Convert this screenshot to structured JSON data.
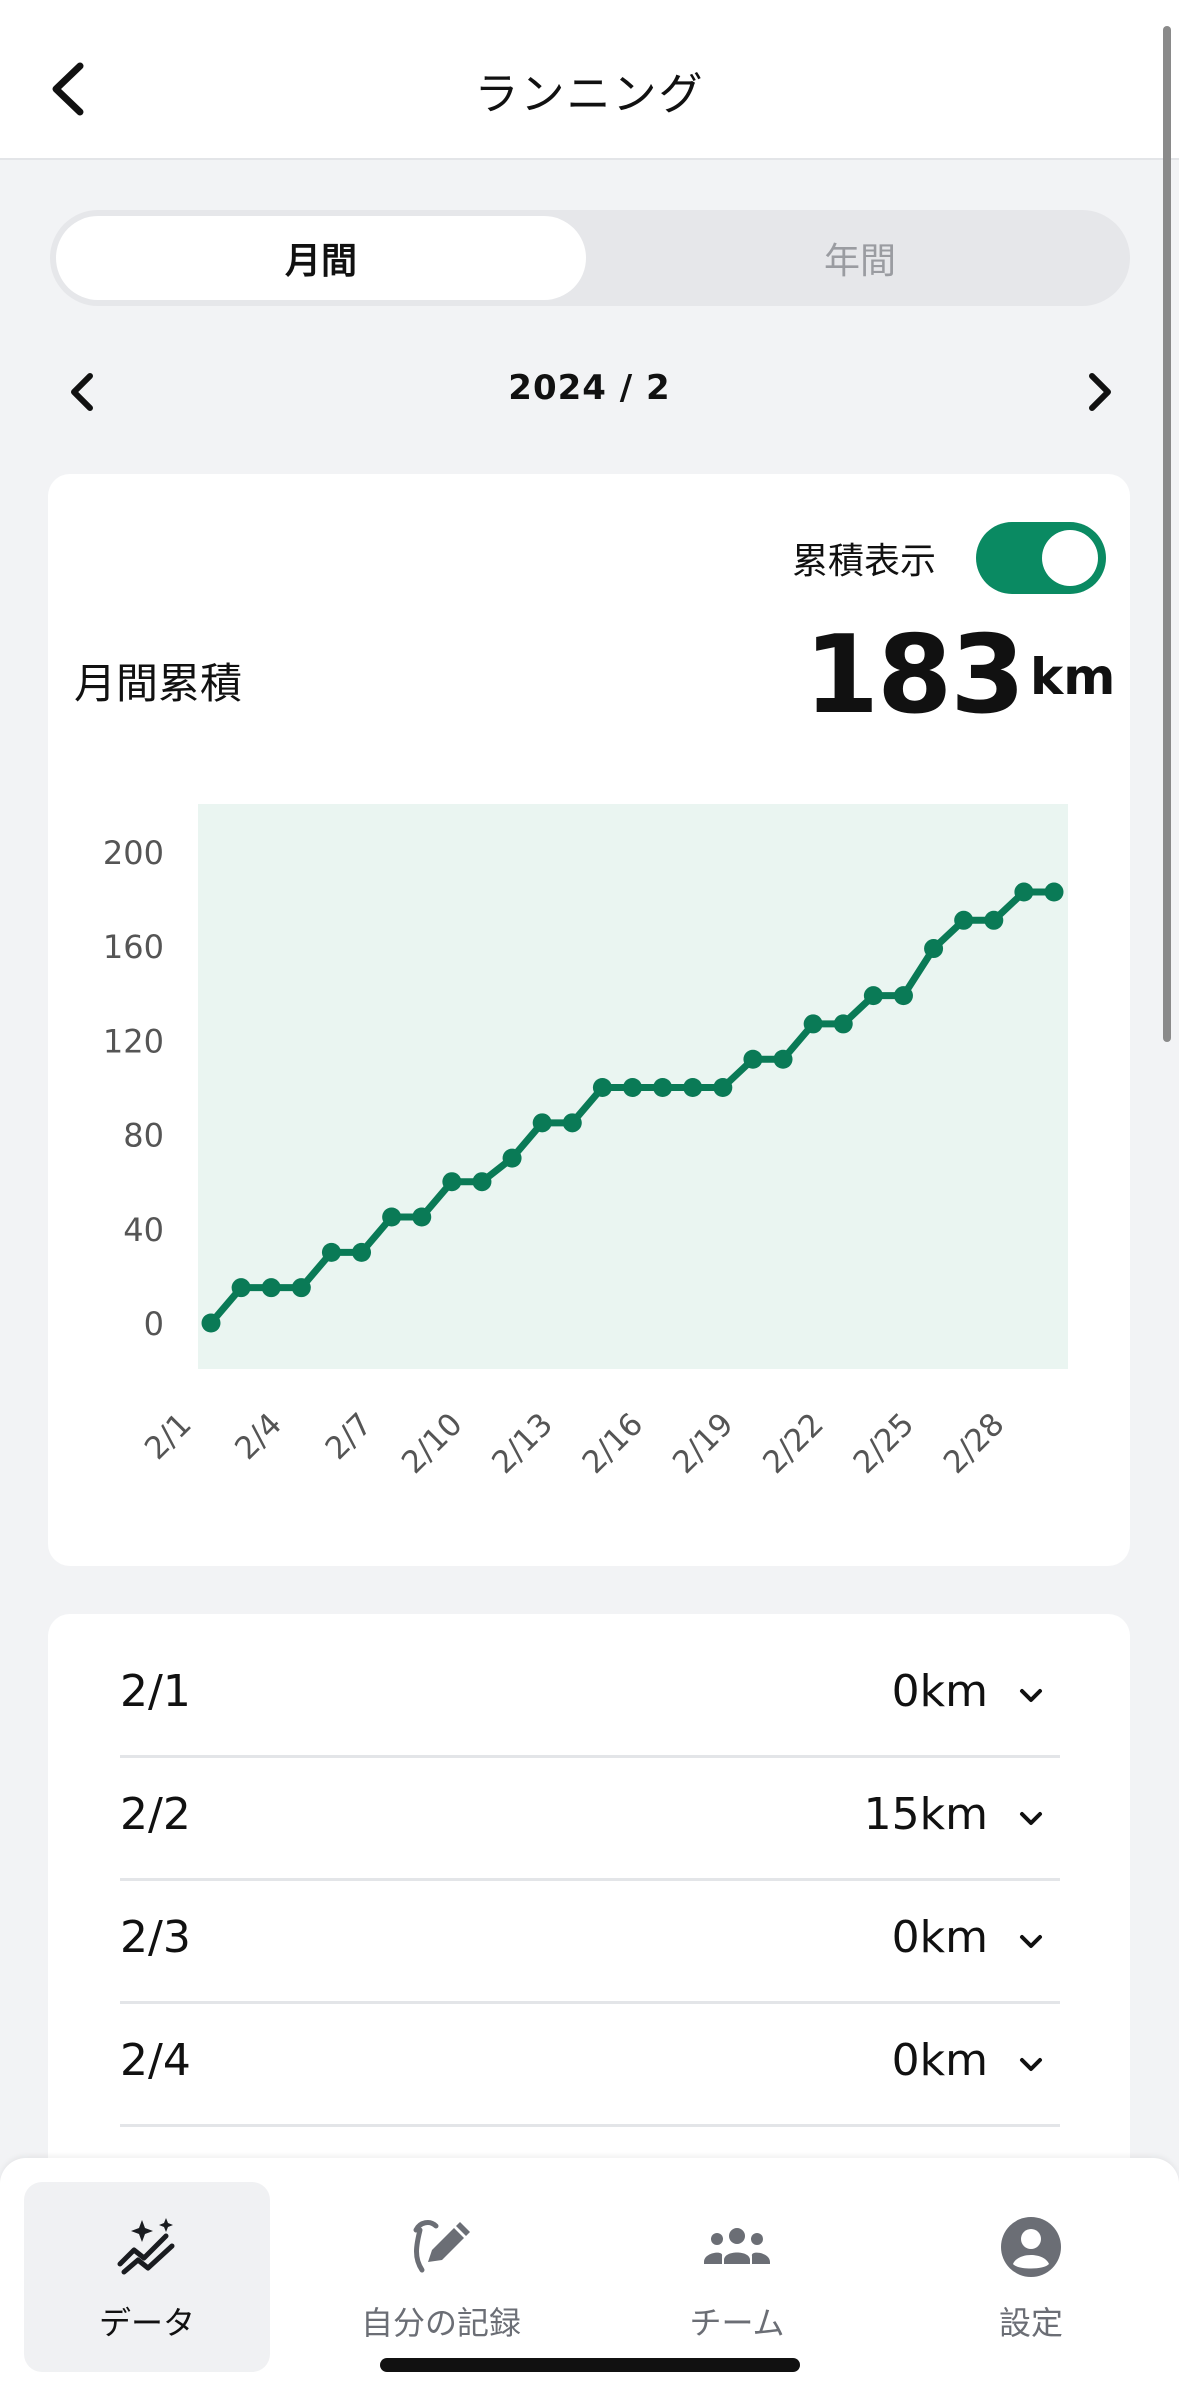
{
  "header": {
    "title": "ランニング"
  },
  "segments": {
    "monthly": "月間",
    "yearly": "年間"
  },
  "month_nav": {
    "label": "2024 / 2"
  },
  "summary": {
    "toggle_label": "累積表示",
    "toggle_on": true,
    "label": "月間累積",
    "value": "183",
    "unit": "km"
  },
  "chart_data": {
    "type": "line",
    "x": [
      "2/1",
      "2/2",
      "2/3",
      "2/4",
      "2/5",
      "2/6",
      "2/7",
      "2/8",
      "2/9",
      "2/10",
      "2/11",
      "2/12",
      "2/13",
      "2/14",
      "2/15",
      "2/16",
      "2/17",
      "2/18",
      "2/19",
      "2/20",
      "2/21",
      "2/22",
      "2/23",
      "2/24",
      "2/25",
      "2/26",
      "2/27",
      "2/28",
      "2/29"
    ],
    "tick_labels": [
      "2/1",
      "2/4",
      "2/7",
      "2/10",
      "2/13",
      "2/16",
      "2/19",
      "2/22",
      "2/25",
      "2/28"
    ],
    "y_ticks": [
      "0",
      "40",
      "80",
      "120",
      "160",
      "200"
    ],
    "series": [
      {
        "values": [
          0,
          15,
          15,
          15,
          30,
          30,
          45,
          45,
          60,
          60,
          70,
          85,
          85,
          100,
          100,
          100,
          100,
          100,
          112,
          112,
          127,
          127,
          139,
          139,
          159,
          171,
          171,
          183,
          183
        ]
      }
    ],
    "ylim": [
      0,
      200
    ],
    "grid": false,
    "colors": {
      "line": "#0a7a56",
      "plot_bg": "#eaf5f1"
    }
  },
  "daily_list": [
    {
      "date": "2/1",
      "value": "0km"
    },
    {
      "date": "2/2",
      "value": "15km"
    },
    {
      "date": "2/3",
      "value": "0km"
    },
    {
      "date": "2/4",
      "value": "0km"
    }
  ],
  "tabbar": [
    {
      "label": "データ",
      "icon": "sparkle-chart-icon",
      "active": true
    },
    {
      "label": "自分の記録",
      "icon": "edit-record-icon",
      "active": false
    },
    {
      "label": "チーム",
      "icon": "team-icon",
      "active": false
    },
    {
      "label": "設定",
      "icon": "account-circle-icon",
      "active": false
    }
  ],
  "colors": {
    "accent": "#0a8a62",
    "background": "#f2f3f5"
  }
}
